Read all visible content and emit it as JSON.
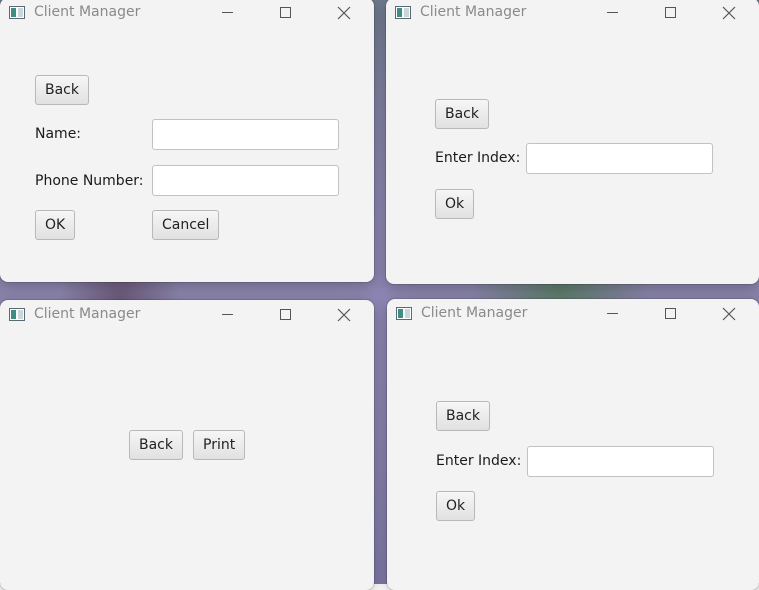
{
  "windows": {
    "add_client": {
      "title": "Client Manager",
      "back_label": "Back",
      "name_label": "Name:",
      "name_value": "",
      "phone_label": "Phone Number:",
      "phone_value": "",
      "ok_label": "OK",
      "cancel_label": "Cancel"
    },
    "index_top": {
      "title": "Client Manager",
      "back_label": "Back",
      "index_label": "Enter Index:",
      "index_value": "",
      "ok_label": "Ok"
    },
    "print": {
      "title": "Client Manager",
      "back_label": "Back",
      "print_label": "Print"
    },
    "index_bottom": {
      "title": "Client Manager",
      "back_label": "Back",
      "index_label": "Enter Index:",
      "index_value": "",
      "ok_label": "Ok"
    }
  },
  "icons": {
    "app": "client-manager-app-icon",
    "minimize": "minimize-icon",
    "maximize": "maximize-icon",
    "close": "close-icon"
  }
}
